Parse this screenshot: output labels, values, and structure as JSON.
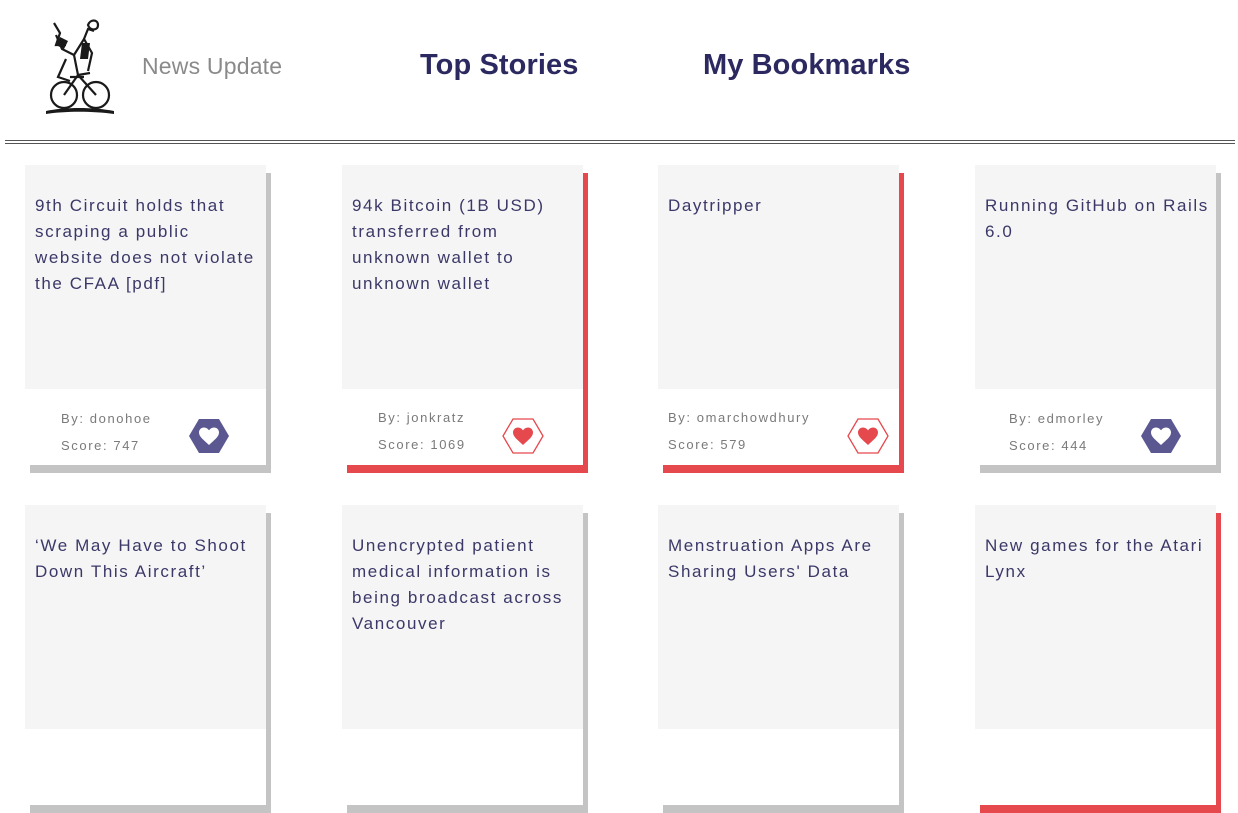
{
  "header": {
    "brand": "News Update",
    "nav": {
      "top_stories": "Top Stories",
      "bookmarks": "My Bookmarks"
    }
  },
  "stories": [
    {
      "title": "9th Circuit holds that scraping a public website does not violate the CFAA [pdf]",
      "author": "By: donohoe",
      "score": "Score: 747",
      "bookmarked": false
    },
    {
      "title": "94k Bitcoin (1B USD) transferred from unknown wallet to unknown wallet",
      "author": "By: jonkratz",
      "score": "Score: 1069",
      "bookmarked": true
    },
    {
      "title": "Daytripper",
      "author": "By: omarchowdhury",
      "score": "Score: 579",
      "bookmarked": true
    },
    {
      "title": "Running GitHub on Rails 6.0",
      "author": "By: edmorley",
      "score": "Score: 444",
      "bookmarked": false
    },
    {
      "title": "‘We May Have to Shoot Down This Aircraft’",
      "bookmarked": false
    },
    {
      "title": "Unencrypted patient medical information is being broadcast across Vancouver",
      "bookmarked": false
    },
    {
      "title": "Menstruation Apps Are Sharing Users' Data",
      "bookmarked": false
    },
    {
      "title": "New games for the Atari Lynx",
      "bookmarked": true
    }
  ],
  "colors": {
    "accent": "#e5484d",
    "brand_navy": "#2b2960",
    "heart_inactive": "#5b5891"
  },
  "icons": {
    "logo": "cyclist-logo-icon",
    "bookmark": "heart-icon"
  }
}
